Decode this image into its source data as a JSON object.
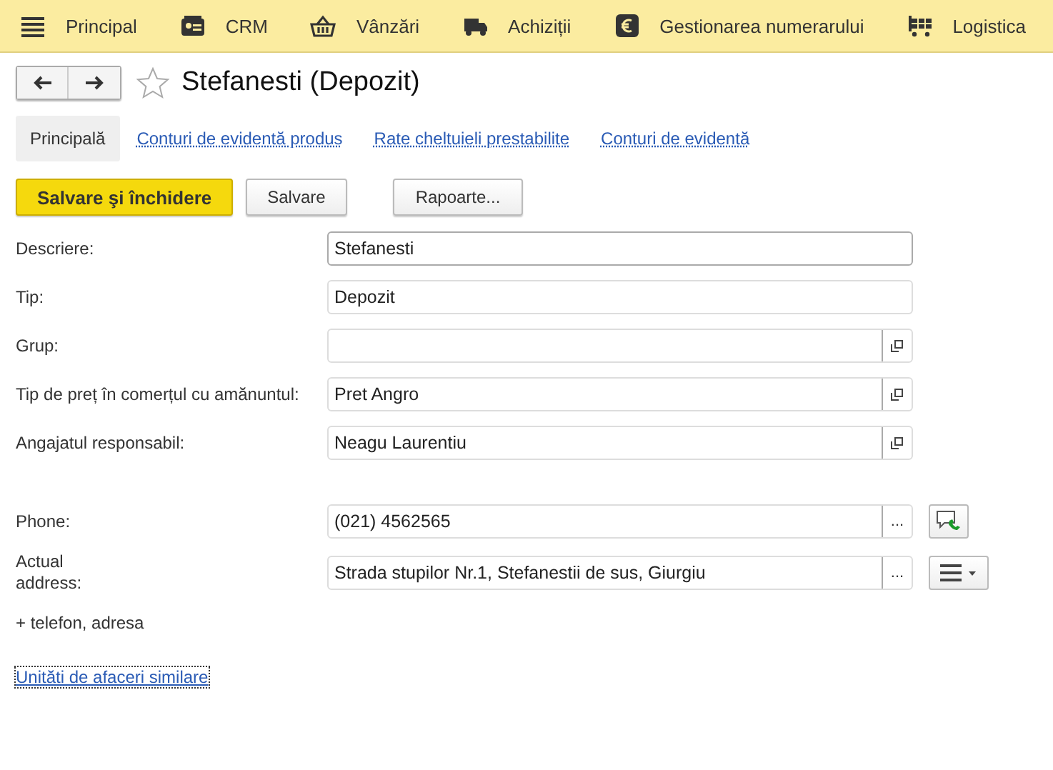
{
  "menu": [
    {
      "label": "Principal",
      "kind": "menu"
    },
    {
      "label": "CRM",
      "kind": "card"
    },
    {
      "label": "Vânzări",
      "kind": "basket"
    },
    {
      "label": "Achiziții",
      "kind": "truck"
    },
    {
      "label": "Gestionarea numerarului",
      "kind": "euro"
    },
    {
      "label": "Logistica",
      "kind": "cart"
    }
  ],
  "header": {
    "title": "Stefanesti (Depozit)",
    "favorite": false
  },
  "tabs": [
    {
      "label": "Principală",
      "selected": true
    },
    {
      "label": "Conturi de evidentă produs",
      "selected": false
    },
    {
      "label": "Rate cheltuieli prestabilite",
      "selected": false
    },
    {
      "label": "Conturi de evidentă",
      "selected": false
    }
  ],
  "toolbar": [
    {
      "label": "Salvare şi închidere",
      "kind": "primary"
    },
    {
      "label": "Salvare",
      "kind": "normal"
    },
    {
      "label": "Rapoarte...",
      "kind": "normal"
    }
  ],
  "fields": [
    {
      "label": "Descriere:",
      "value": "Stefanesti",
      "kind": "text",
      "focused": true
    },
    {
      "label": "Tip:",
      "value": "Depozit",
      "kind": "text",
      "focused": false
    },
    {
      "label": "Grup:",
      "kind": "choice",
      "focused": false
    },
    {
      "label": "Tip de preț în comerțul cu amănuntul:",
      "value": "Pret Angro",
      "kind": "choice",
      "focused": false
    },
    {
      "label": "Angajatul responsabil:",
      "value": "Neagu Laurentiu",
      "kind": "choice",
      "focused": false
    }
  ],
  "contacts": [
    {
      "label": "Phone:",
      "value": "(021) 4562565",
      "picker": "...",
      "kind": "phone"
    },
    {
      "label": "Actual address:",
      "value": "Strada stupilor Nr.1, Stefanestii de sus, Giurgiu",
      "picker": "...",
      "kind": "menu"
    }
  ],
  "add_contact": "+ telefon, adresa",
  "related_link": "Unităti de afaceri similare"
}
